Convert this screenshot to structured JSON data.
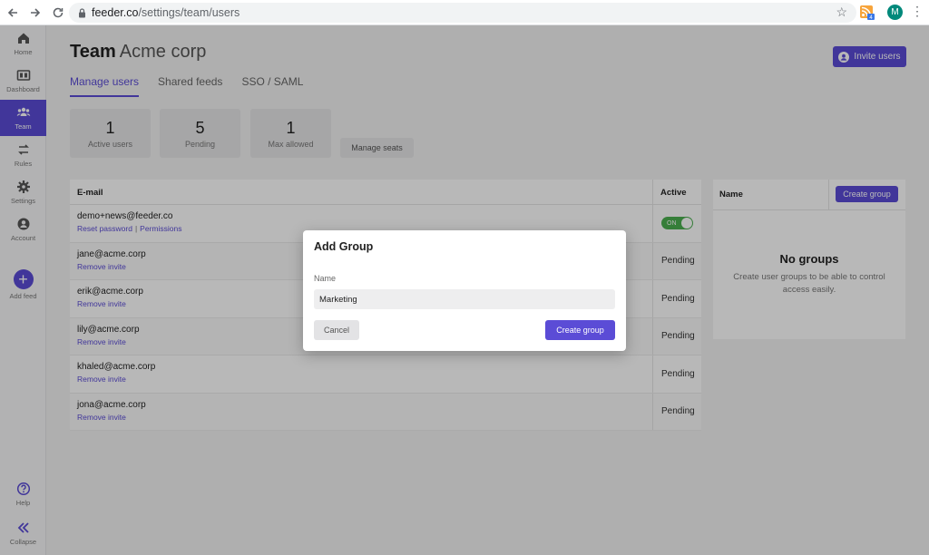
{
  "browser": {
    "url_host": "feeder.co",
    "url_path": "/settings/team/users",
    "avatar_initial": "M",
    "extension_badge": "4"
  },
  "sidebar": {
    "items": [
      {
        "label": "Home",
        "icon": "home-icon"
      },
      {
        "label": "Dashboard",
        "icon": "dashboard-icon"
      },
      {
        "label": "Team",
        "icon": "team-icon",
        "active": true
      },
      {
        "label": "Rules",
        "icon": "rules-icon"
      },
      {
        "label": "Settings",
        "icon": "gear-icon"
      },
      {
        "label": "Account",
        "icon": "account-icon"
      },
      {
        "label": "Add feed",
        "icon": "plus-icon"
      }
    ],
    "bottom": [
      {
        "label": "Help",
        "icon": "help-icon"
      },
      {
        "label": "Collapse",
        "icon": "double-chevron-left-icon"
      }
    ]
  },
  "header": {
    "title_bold": "Team",
    "org_name": "Acme corp",
    "invite_label": "Invite users"
  },
  "tabs": [
    "Manage users",
    "Shared feeds",
    "SSO / SAML"
  ],
  "stats": [
    {
      "value": "1",
      "label": "Active users"
    },
    {
      "value": "5",
      "label": "Pending"
    },
    {
      "value": "1",
      "label": "Max allowed"
    }
  ],
  "manage_seats_label": "Manage seats",
  "users_table": {
    "columns": [
      "E-mail",
      "Active"
    ],
    "rows": [
      {
        "email": "demo+news@feeder.co",
        "links": [
          "Reset password",
          "Permissions"
        ],
        "status": "ON"
      },
      {
        "email": "jane@acme.corp",
        "links": [
          "Remove invite"
        ],
        "status": "Pending"
      },
      {
        "email": "erik@acme.corp",
        "links": [
          "Remove invite"
        ],
        "status": "Pending"
      },
      {
        "email": "lily@acme.corp",
        "links": [
          "Remove invite"
        ],
        "status": "Pending"
      },
      {
        "email": "khaled@acme.corp",
        "links": [
          "Remove invite"
        ],
        "status": "Pending"
      },
      {
        "email": "jona@acme.corp",
        "links": [
          "Remove invite"
        ],
        "status": "Pending"
      }
    ]
  },
  "groups": {
    "header": "Name",
    "create_label": "Create group",
    "empty_title": "No groups",
    "empty_desc": "Create user groups to be able to control access easily."
  },
  "modal": {
    "title": "Add Group",
    "name_label": "Name",
    "name_value": "Marketing",
    "cancel_label": "Cancel",
    "create_label": "Create group"
  },
  "colors": {
    "accent": "#5b4cd6",
    "toggle_on": "#4caf50"
  }
}
